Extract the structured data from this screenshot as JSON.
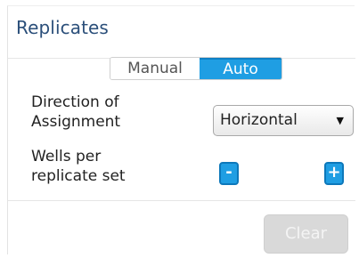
{
  "panel": {
    "title": "Replicates"
  },
  "mode_toggle": {
    "options": [
      "Manual",
      "Auto"
    ],
    "selected": "Auto"
  },
  "direction": {
    "label_line1": "Direction of",
    "label_line2": "Assignment",
    "selected_value": "Horizontal"
  },
  "wells": {
    "label_line1": "Wells per",
    "label_line2": "replicate set",
    "minus_label": "-",
    "plus_label": "+",
    "value": ""
  },
  "actions": {
    "clear_label": "Clear"
  },
  "colors": {
    "accent": "#1f9ee3",
    "title": "#2b4f7a"
  },
  "icons": {
    "dropdown": "triangle-down-icon"
  }
}
